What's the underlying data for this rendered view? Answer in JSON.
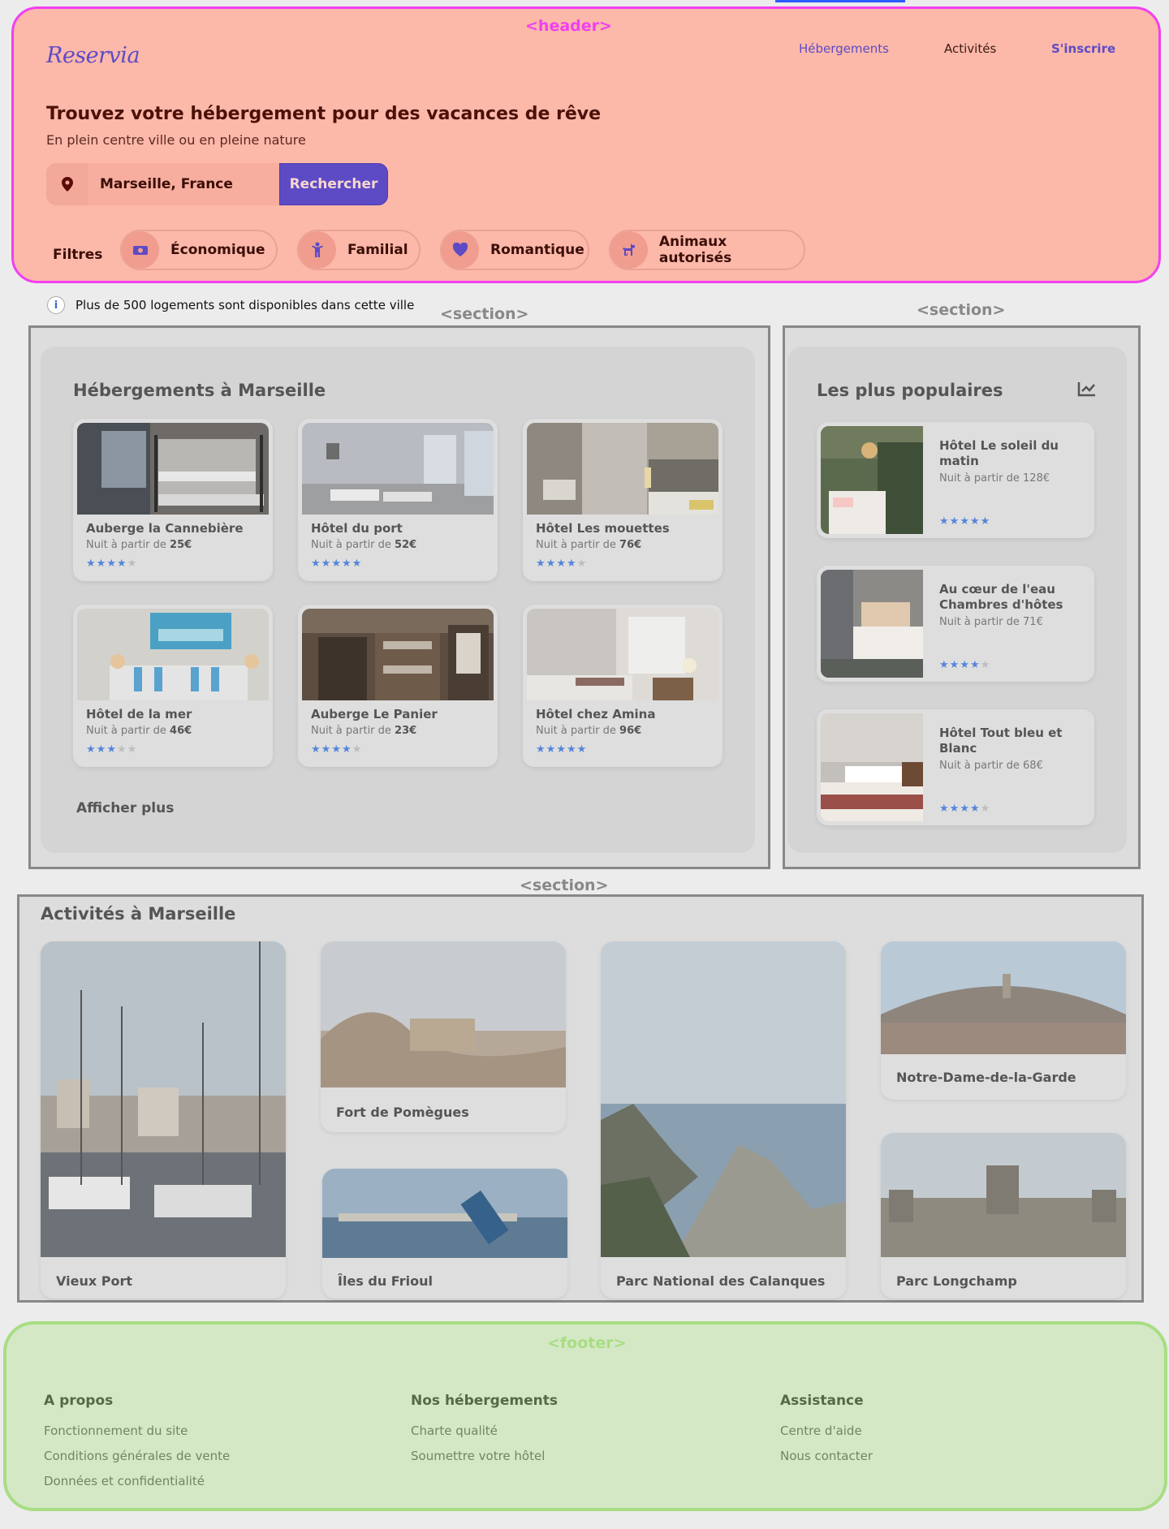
{
  "annotations": {
    "header_tag": "<header>",
    "section_tag": "<section>",
    "footer_tag": "<footer>"
  },
  "colors": {
    "accent": "#5d4bc6",
    "star_on": "#5585db",
    "star_off": "#bdbdbd",
    "header_bg": "#fcb8a9",
    "footer_bg": "#d5e8c6"
  },
  "header": {
    "logo": "Reservia",
    "nav": [
      "Hébergements",
      "Activités",
      "S'inscrire"
    ],
    "title": "Trouvez votre hébergement pour des vacances de rêve",
    "subtitle": "En plein centre ville ou en pleine nature",
    "search": {
      "value": "Marseille, France",
      "button": "Rechercher",
      "icon": "map-pin-icon"
    },
    "filters_label": "Filtres",
    "filters": [
      {
        "label": "Économique",
        "icon": "money-icon"
      },
      {
        "label": "Familial",
        "icon": "child-icon"
      },
      {
        "label": "Romantique",
        "icon": "heart-icon"
      },
      {
        "label": "Animaux autorisés",
        "icon": "dog-icon"
      }
    ]
  },
  "info": {
    "icon": "info-icon",
    "text": "Plus de 500 logements sont disponibles dans cette ville"
  },
  "hebergements": {
    "title": "Hébergements à Marseille",
    "price_prefix": "Nuit à partir de",
    "cards": [
      {
        "name": "Auberge la Cannebière",
        "price": "25€",
        "rating": 4
      },
      {
        "name": "Hôtel du port",
        "price": "52€",
        "rating": 5
      },
      {
        "name": "Hôtel Les mouettes",
        "price": "76€",
        "rating": 4
      },
      {
        "name": "Hôtel de la mer",
        "price": "46€",
        "rating": 3
      },
      {
        "name": "Auberge Le Panier",
        "price": "23€",
        "rating": 4
      },
      {
        "name": "Hôtel chez Amina",
        "price": "96€",
        "rating": 5
      }
    ],
    "more": "Afficher plus"
  },
  "populaires": {
    "title": "Les plus populaires",
    "icon": "trending-chart-icon",
    "items": [
      {
        "name": "Hôtel Le soleil du matin",
        "price": "Nuit à partir de 128€",
        "rating": 5
      },
      {
        "name": "Au cœur de l'eau Chambres d'hôtes",
        "price": "Nuit à partir de 71€",
        "rating": 4
      },
      {
        "name": "Hôtel Tout bleu et Blanc",
        "price": "Nuit à partir de 68€",
        "rating": 4
      }
    ]
  },
  "activites": {
    "title": "Activités à Marseille",
    "items": [
      "Vieux Port",
      "Fort de Pomègues",
      "Îles du Frioul",
      "Parc National des Calanques",
      "Notre-Dame-de-la-Garde",
      "Parc Longchamp"
    ]
  },
  "footer": {
    "columns": [
      {
        "title": "A propos",
        "links": [
          "Fonctionnement du site",
          "Conditions générales de vente",
          "Données et confidentialité"
        ]
      },
      {
        "title": "Nos hébergements",
        "links": [
          "Charte qualité",
          "Soumettre votre hôtel"
        ]
      },
      {
        "title": "Assistance",
        "links": [
          "Centre d'aide",
          "Nous contacter"
        ]
      }
    ]
  }
}
